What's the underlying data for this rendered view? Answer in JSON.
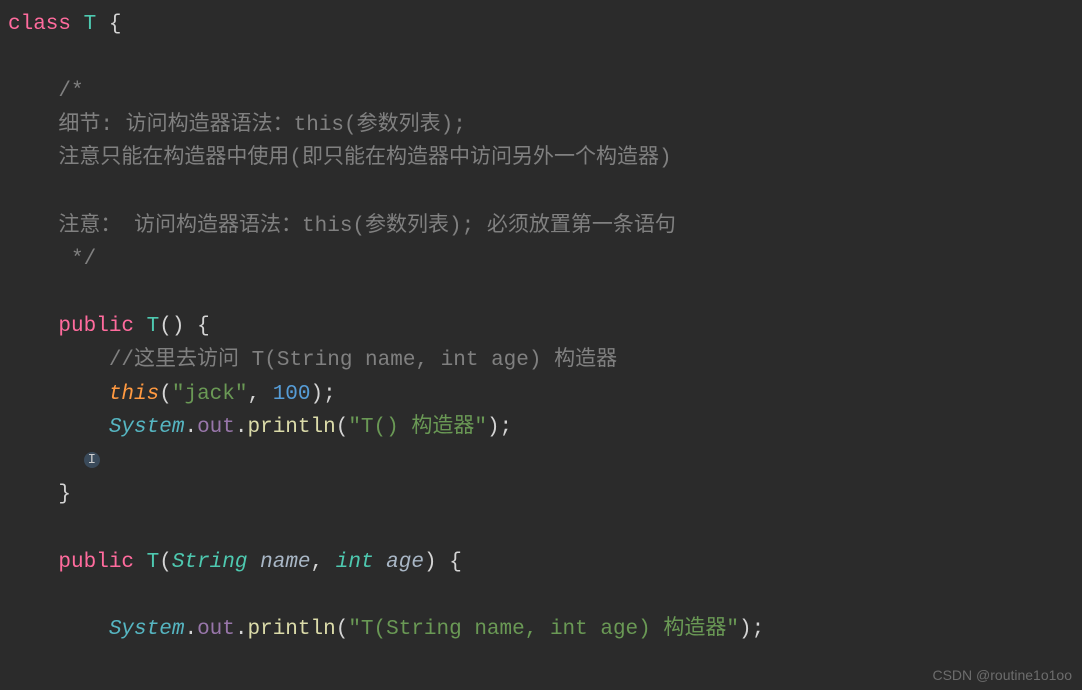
{
  "code": {
    "line1_class": "class",
    "line1_name": "T",
    "line1_brace": " {",
    "comment_open": "/*",
    "comment_l1": "细节: 访问构造器语法：this(参数列表);",
    "comment_l2": "注意只能在构造器中使用(即只能在构造器中访问另外一个构造器)",
    "comment_l3": "注意： 访问构造器语法：this(参数列表); 必须放置第一条语句",
    "comment_close": " */",
    "ctor1_public": "public",
    "ctor1_name": "T",
    "ctor1_paren": "() {",
    "ctor1_comment": "//这里去访问 T(String name, int age) 构造器",
    "ctor1_this": "this",
    "ctor1_args_open": "(",
    "ctor1_str": "\"jack\"",
    "ctor1_comma": ", ",
    "ctor1_num": "100",
    "ctor1_args_close": ");",
    "ctor1_system": "System",
    "ctor1_out": "out",
    "ctor1_println": "println",
    "ctor1_msg": "\"T() 构造器\"",
    "ctor1_end": ");",
    "ctor1_close": "}",
    "ctor2_public": "public",
    "ctor2_name": "T",
    "ctor2_paren_open": "(",
    "ctor2_ptype1": "String",
    "ctor2_pname1": "name",
    "ctor2_comma": ", ",
    "ctor2_ptype2": "int",
    "ctor2_pname2": "age",
    "ctor2_paren_close": ") {",
    "ctor2_system": "System",
    "ctor2_out": "out",
    "ctor2_println": "println",
    "ctor2_msg": "\"T(String name, int age) 构造器\"",
    "ctor2_end": ");"
  },
  "watermark": "CSDN @routine1o1oo"
}
